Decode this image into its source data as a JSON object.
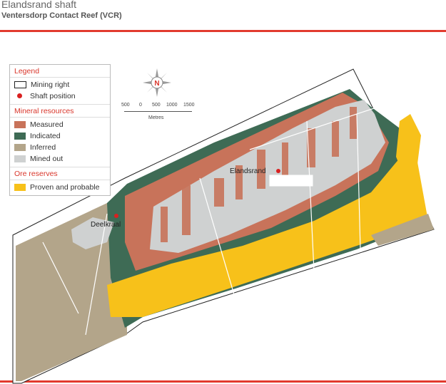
{
  "header": {
    "title": "Elandsrand shaft",
    "subtitle": "Ventersdorp Contact Reef (VCR)"
  },
  "legend": {
    "heading": "Legend",
    "mining_right": "Mining right",
    "shaft_position": "Shaft position",
    "mineral_resources_heading": "Mineral resources",
    "measured": "Measured",
    "indicated": "Indicated",
    "inferred": "Inferred",
    "mined_out": "Mined out",
    "ore_reserves_heading": "Ore reserves",
    "proven_probable": "Proven and probable"
  },
  "scale_bar": {
    "ticks": [
      "500",
      "0",
      "500",
      "1000",
      "1500"
    ],
    "unit": "Metres"
  },
  "compass": {
    "label": "N"
  },
  "places": {
    "elandsrand": "Elandsrand",
    "deelkraal": "Deelkraal"
  },
  "colors": {
    "accent_rule": "#e23b2e",
    "measured": "#c8735a",
    "indicated": "#3e6b55",
    "inferred": "#b3a58a",
    "mined_out": "#cfd1d1",
    "proven_probable": "#f7c11a",
    "shaft": "#d92020"
  }
}
